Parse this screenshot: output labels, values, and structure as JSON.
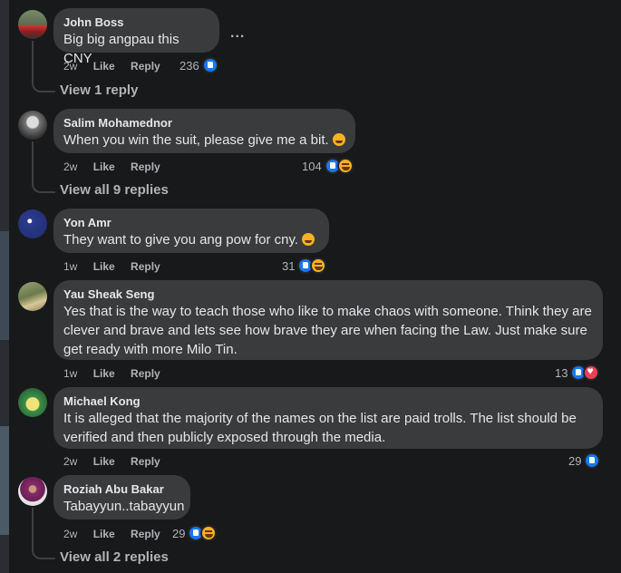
{
  "colors": {
    "background": "#18191a",
    "bubble": "#3a3b3c",
    "like_blue": "#1877f2",
    "haha_yellow": "#f7b125",
    "love_red": "#f33e58"
  },
  "more_options": "...",
  "comments": [
    {
      "author": "John Boss",
      "text": "Big big angpau this CNY",
      "time": "2w",
      "like": "Like",
      "reply": "Reply",
      "reactions_count": "236",
      "reactions": [
        "like"
      ],
      "view_replies": "View 1 reply",
      "avatar": "car-avatar"
    },
    {
      "author": "Salim Mohamednor",
      "text": "When you win the suit, please give me a bit.",
      "emoji": "grin",
      "time": "2w",
      "like": "Like",
      "reply": "Reply",
      "reactions_count": "104",
      "reactions": [
        "like",
        "haha"
      ],
      "view_replies": "View all 9 replies",
      "avatar": "person-avatar"
    },
    {
      "author": "Yon Amr",
      "text": "They want to give you ang pow for cny.",
      "emoji": "laugh",
      "time": "1w",
      "like": "Like",
      "reply": "Reply",
      "reactions_count": "31",
      "reactions": [
        "like",
        "haha"
      ],
      "avatar": "flag-avatar"
    },
    {
      "author": "Yau Sheak Seng",
      "text": "Yes that is the way to teach those who like to make chaos with someone. Think they are clever and brave and lets see how brave they are when facing the Law. Just make sure get ready with more Milo Tin.",
      "time": "1w",
      "like": "Like",
      "reply": "Reply",
      "reactions_count": "13",
      "reactions": [
        "like",
        "love"
      ],
      "avatar": "landscape-avatar"
    },
    {
      "author": "Michael Kong",
      "text": "It is alleged that the majority of the names on the list are paid trolls. The list should be verified and then publicly exposed through the media.",
      "time": "2w",
      "like": "Like",
      "reply": "Reply",
      "reactions_count": "29",
      "reactions": [
        "like"
      ],
      "avatar": "cartoon-avatar"
    },
    {
      "author": "Roziah Abu Bakar",
      "text": "Tabayyun..tabayyun",
      "time": "2w",
      "like": "Like",
      "reply": "Reply",
      "reactions_count": "29",
      "reactions": [
        "like",
        "haha"
      ],
      "view_replies": "View all 2 replies",
      "avatar": "woman-avatar"
    }
  ]
}
